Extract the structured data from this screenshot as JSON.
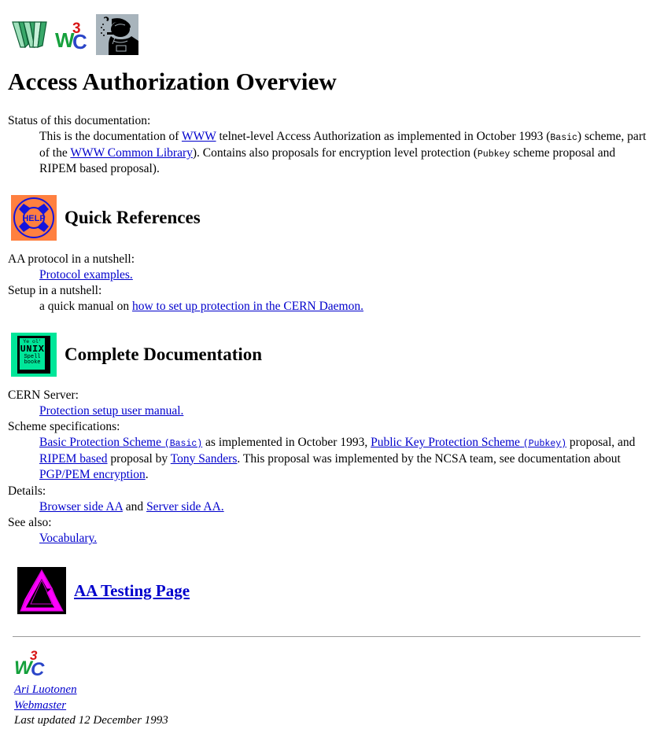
{
  "header": {
    "logos": [
      {
        "name": "www-logo",
        "alt": "WWW"
      },
      {
        "name": "w3c-logo",
        "alt": "W3C",
        "w": "W",
        "sup": "3",
        "c": "C"
      },
      {
        "name": "detective-logo",
        "alt": "Detective"
      }
    ]
  },
  "page_title": "Access Authorization Overview",
  "status": {
    "term": "Status of this documentation:",
    "text_1": "This is the documentation of ",
    "link_www": "WWW",
    "text_2": " telnet-level Access Authorization as implemented in October 1993 (",
    "mono_basic": "Basic",
    "text_3": ") scheme, part of the ",
    "link_common_library": "WWW Common Library",
    "text_4": "). Contains also proposals for encryption level protection (",
    "mono_pubkey": "Pubkey",
    "text_5": " scheme proposal and RIPEM based proposal)."
  },
  "quick_references": {
    "icon": "help-life-ring-icon",
    "icon_label": "HELP",
    "heading": "Quick References",
    "items": [
      {
        "term": "AA protocol in a nutshell:",
        "lead": "",
        "link": "Protocol examples.",
        "tail": ""
      },
      {
        "term": "Setup in a nutshell:",
        "lead": "a quick manual on ",
        "link": "how to set up protection in the CERN Daemon.",
        "tail": ""
      }
    ]
  },
  "complete_documentation": {
    "icon": "unix-spell-book-icon",
    "icon_lines": [
      "Ye ol'",
      "UNIX",
      "Spell",
      "booke"
    ],
    "heading": "Complete Documentation",
    "cern_server": {
      "term": "CERN Server:",
      "link": "Protection setup user manual."
    },
    "scheme_specs": {
      "term": "Scheme specifications:",
      "link_basic": "Basic Protection Scheme",
      "link_basic_mono": "(Basic)",
      "text_1": " as implemented in October 1993, ",
      "link_pubkey": "Public Key Protection Scheme",
      "link_pubkey_mono": "(Pubkey)",
      "text_2": " proposal, and ",
      "link_ripem": "RIPEM based",
      "text_3": " proposal by ",
      "link_sanders": "Tony Sanders",
      "text_4": ". This proposal was implemented by the NCSA team, see documentation about ",
      "link_pgp": "PGP/PEM encryption",
      "text_5": "."
    },
    "details": {
      "term": "Details:",
      "link_browser": "Browser side AA",
      "joiner": " and ",
      "link_server": "Server side AA."
    },
    "see_also": {
      "term": "See also:",
      "link_vocabulary": "Vocabulary."
    }
  },
  "testing": {
    "icon": "penrose-triangle-icon",
    "link": "AA Testing Page"
  },
  "footer": {
    "logo": "w3c-logo",
    "w": "W",
    "sup": "3",
    "c": "C",
    "author_link": "Ari Luotonen",
    "role_link": "Webmaster",
    "last_updated": "Last updated 12 December 1993"
  },
  "colors": {
    "link": "#0000cc",
    "w3c_green": "#15a03c",
    "w3c_red": "#d81515",
    "w3c_blue": "#2b46c8",
    "help_bg": "#ff8040",
    "book_bg": "#00e699",
    "penrose": "#ff00ff",
    "rule": "#9a9a9a"
  }
}
